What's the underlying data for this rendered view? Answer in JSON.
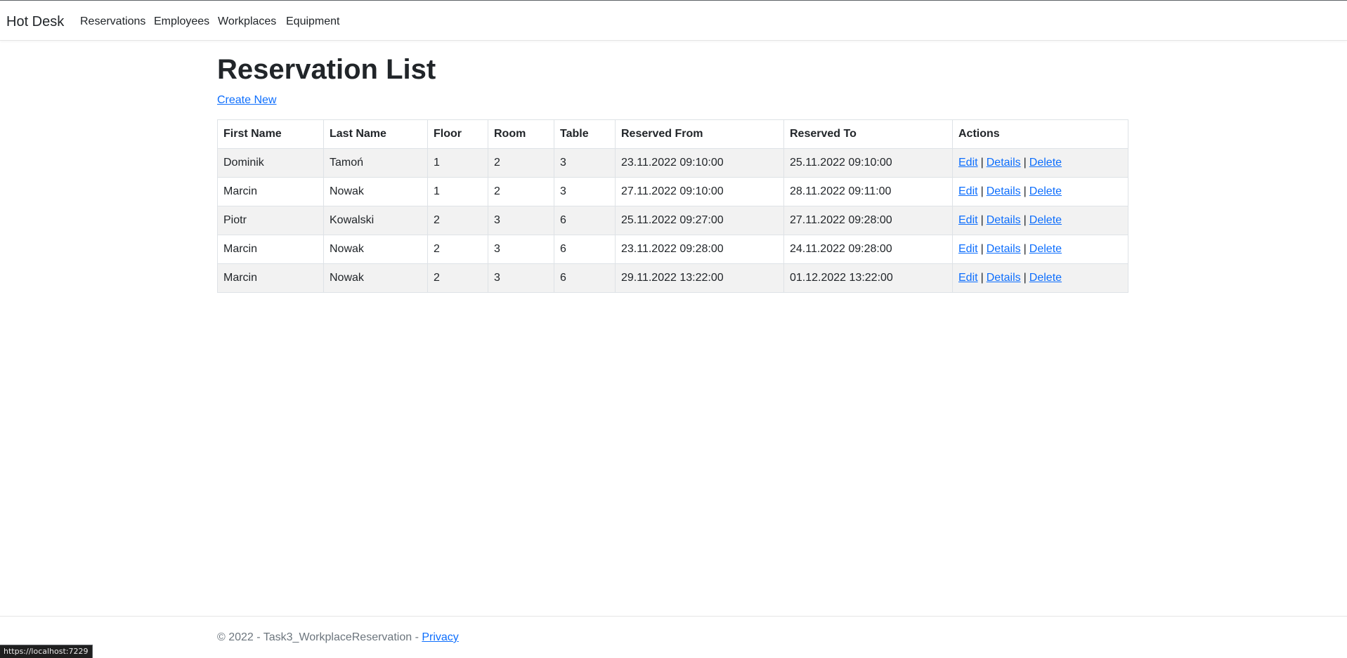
{
  "navbar": {
    "brand": "Hot Desk",
    "links": [
      "Reservations",
      "Employees",
      "Workplaces",
      "Equipment"
    ]
  },
  "page": {
    "title": "Reservation List",
    "create_link": "Create New"
  },
  "table": {
    "headers": [
      "First Name",
      "Last Name",
      "Floor",
      "Room",
      "Table",
      "Reserved From",
      "Reserved To",
      "Actions"
    ],
    "rows": [
      [
        "Dominik",
        "Tamoń",
        "1",
        "2",
        "3",
        "23.11.2022 09:10:00",
        "25.11.2022 09:10:00"
      ],
      [
        "Marcin",
        "Nowak",
        "1",
        "2",
        "3",
        "27.11.2022 09:10:00",
        "28.11.2022 09:11:00"
      ],
      [
        "Piotr",
        "Kowalski",
        "2",
        "3",
        "6",
        "25.11.2022 09:27:00",
        "27.11.2022 09:28:00"
      ],
      [
        "Marcin",
        "Nowak",
        "2",
        "3",
        "6",
        "23.11.2022 09:28:00",
        "24.11.2022 09:28:00"
      ],
      [
        "Marcin",
        "Nowak",
        "2",
        "3",
        "6",
        "29.11.2022 13:22:00",
        "01.12.2022 13:22:00"
      ]
    ],
    "actions": {
      "edit": "Edit",
      "details": "Details",
      "delete": "Delete",
      "separator": "|"
    }
  },
  "footer": {
    "text": "© 2022 - Task3_WorkplaceReservation - ",
    "privacy": "Privacy"
  },
  "statusbar": {
    "url": "https://localhost:7229"
  },
  "colors": {
    "link": "#0d6efd",
    "stripe": "#f2f2f2",
    "text": "#212529",
    "muted": "#6c757d"
  }
}
